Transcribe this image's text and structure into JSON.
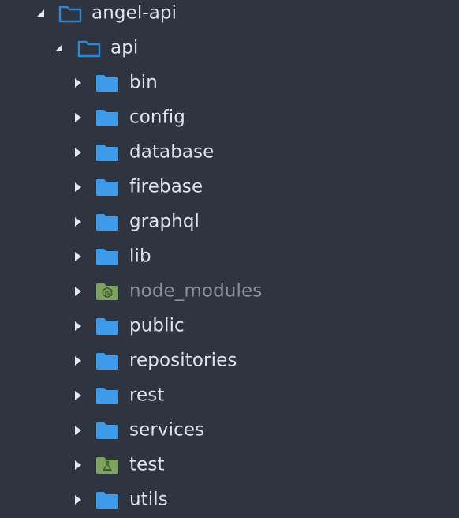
{
  "theme": {
    "background": "#2e3440",
    "text": "#dfe3ea",
    "text_dim": "#8b919b",
    "folder_blue": "#3f9be9",
    "folder_open_outline": "#2f86d1",
    "folder_node": "#7ea360",
    "folder_test": "#7ea360"
  },
  "tree": {
    "root": {
      "label": "angel-api",
      "expanded": true,
      "icon": "folder-open-icon"
    },
    "api": {
      "label": "api",
      "expanded": true,
      "icon": "folder-open-icon"
    },
    "children": [
      {
        "label": "bin",
        "icon": "folder-icon"
      },
      {
        "label": "config",
        "icon": "folder-icon"
      },
      {
        "label": "database",
        "icon": "folder-icon"
      },
      {
        "label": "firebase",
        "icon": "folder-icon"
      },
      {
        "label": "graphql",
        "icon": "folder-icon"
      },
      {
        "label": "lib",
        "icon": "folder-icon"
      },
      {
        "label": "node_modules",
        "icon": "nodejs-folder-icon",
        "dimmed": true
      },
      {
        "label": "public",
        "icon": "folder-icon"
      },
      {
        "label": "repositories",
        "icon": "folder-icon"
      },
      {
        "label": "rest",
        "icon": "folder-icon"
      },
      {
        "label": "services",
        "icon": "folder-icon"
      },
      {
        "label": "test",
        "icon": "flask-folder-icon"
      },
      {
        "label": "utils",
        "icon": "folder-icon"
      }
    ]
  }
}
